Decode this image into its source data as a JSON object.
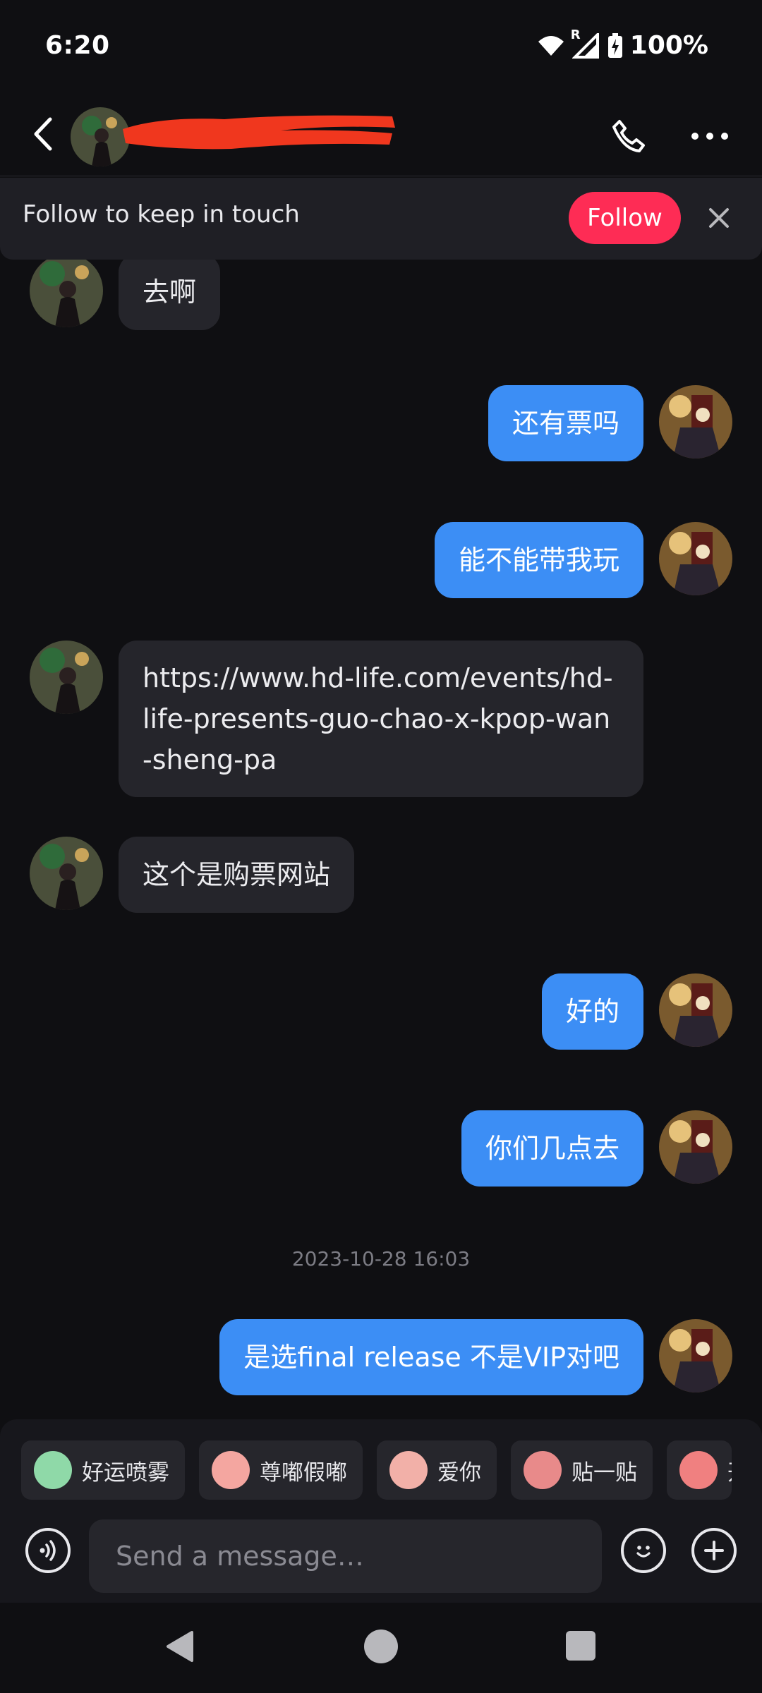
{
  "status_bar": {
    "time": "6:20",
    "battery_percent": "100%",
    "network_roaming": "R",
    "icons": [
      "wifi-icon",
      "signal-icon",
      "battery-charging-icon"
    ]
  },
  "header": {
    "contact_name_redacted": true,
    "actions": [
      "call-icon",
      "more-icon"
    ]
  },
  "follow_banner": {
    "text": "Follow to keep in touch",
    "button_label": "Follow"
  },
  "messages": [
    {
      "side": "in",
      "text": "去啊"
    },
    {
      "side": "out",
      "text": "还有票吗"
    },
    {
      "side": "out",
      "text": "能不能带我玩"
    },
    {
      "side": "in",
      "text": "https://www.hd-life.com/events/hd-life-presents-guo-chao-x-kpop-wan-sheng-pa"
    },
    {
      "side": "in",
      "text": "这个是购票网站"
    },
    {
      "side": "out",
      "text": "好的"
    },
    {
      "side": "out",
      "text": "你们几点去"
    },
    {
      "type": "timestamp",
      "text": "2023-10-28 16:03"
    },
    {
      "side": "out",
      "text": "是选final release 不是VIP对吧"
    }
  ],
  "stickers": [
    {
      "label": "好运喷雾",
      "color": "#8fd9a8"
    },
    {
      "label": "尊嘟假嘟",
      "color": "#f4a6a0"
    },
    {
      "label": "爱你",
      "color": "#f2b0a8"
    },
    {
      "label": "贴一贴",
      "color": "#e88a8a"
    },
    {
      "label": "开",
      "color": "#f08080"
    }
  ],
  "composer": {
    "placeholder": "Send a message…"
  },
  "colors": {
    "accent": "#3c8ef5",
    "follow": "#fe2c55",
    "background": "#0f0f12"
  }
}
